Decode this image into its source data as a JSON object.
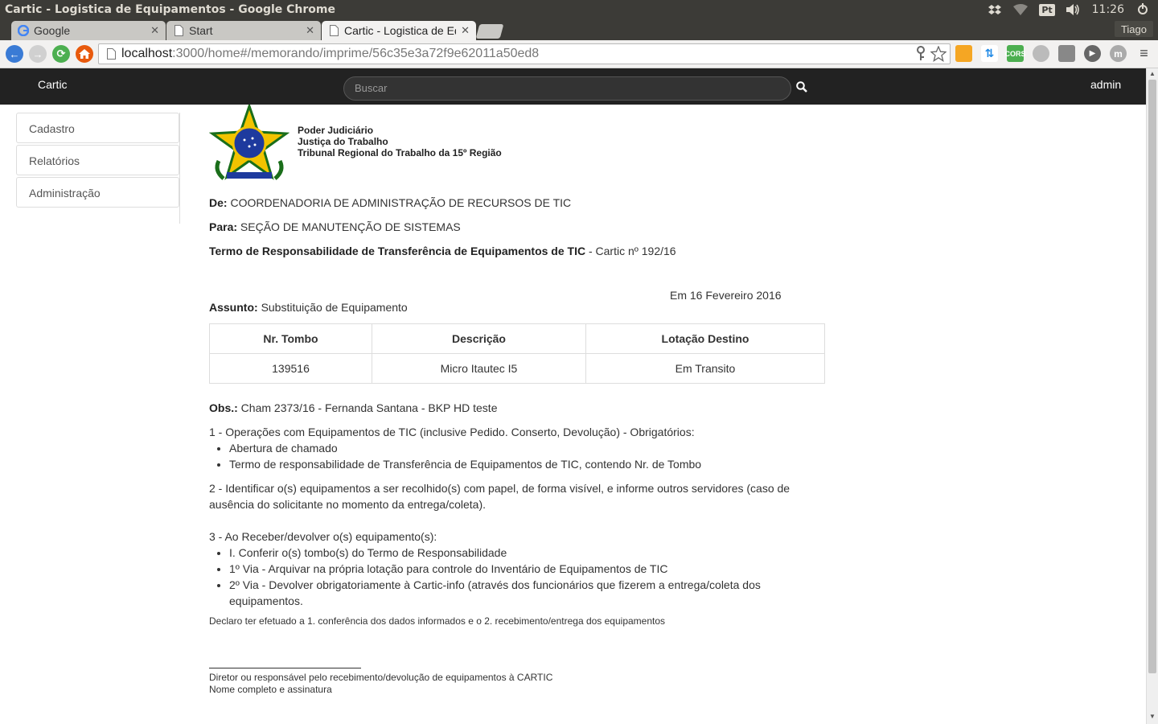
{
  "os": {
    "window_title": "Cartic - Logistica de Equipamentos - Google Chrome",
    "keyboard_layout": "Pt",
    "clock": "11:26"
  },
  "browser": {
    "tabs": [
      {
        "label": "Google",
        "active": false
      },
      {
        "label": "Start",
        "active": false
      },
      {
        "label": "Cartic - Logistica de Equipamentos",
        "active": true
      }
    ],
    "profile_name": "Tiago",
    "url_host": "localhost",
    "url_rest": ":3000/home#/memorando/imprime/56c35e3a72f9e62011a50ed8",
    "extension_cors_label": "CORS",
    "extension_m_label": "m"
  },
  "navbar": {
    "brand": "Cartic",
    "search_placeholder": "Buscar",
    "user": "admin"
  },
  "sidebar": {
    "items": [
      {
        "label": "Cadastro"
      },
      {
        "label": "Relatórios"
      },
      {
        "label": "Administração"
      }
    ]
  },
  "document": {
    "org_line1": "Poder Judiciário",
    "org_line2": "Justiça do Trabalho",
    "org_line3": "Tribunal Regional do Trabalho da 15º Região",
    "from_label": "De:",
    "from_value": "COORDENADORIA DE ADMINISTRAÇÃO DE RECURSOS DE TIC",
    "to_label": "Para:",
    "to_value": "SEÇÃO DE MANUTENÇÃO DE SISTEMAS",
    "term_title": "Termo de Responsabilidade de Transferência de Equipamentos de TIC",
    "term_number": "- Cartic nº 192/16",
    "date": "Em 16 Fevereiro 2016",
    "subject_label": "Assunto:",
    "subject_value": "Substituição de Equipamento",
    "table": {
      "headers": [
        "Nr. Tombo",
        "Descrição",
        "Lotação Destino"
      ],
      "rows": [
        [
          "139516",
          "Micro Itautec I5",
          "Em Transito"
        ]
      ]
    },
    "obs_label": "Obs.:",
    "obs_value": "Cham 2373/16 - Fernanda Santana - BKP HD teste",
    "section1_title": "1 - Operações com Equipamentos de TIC (inclusive Pedido. Conserto, Devolução) - Obrigatórios:",
    "section1_items": [
      "Abertura de chamado",
      "Termo de responsabilidade de Transferência de Equipamentos de TIC, contendo Nr. de Tombo"
    ],
    "section2": "2 - Identificar o(s) equipamentos a ser recolhido(s) com papel, de forma visível, e informe outros servidores (caso de ausência do solicitante no momento da entrega/coleta).",
    "section3_title": "3 - Ao Receber/devolver o(s) equipamento(s):",
    "section3_items": [
      "I. Conferir o(s) tombo(s) do Termo de Responsabilidade",
      "1º Via - Arquivar na própria lotação para controle do Inventário de Equipamentos de TIC",
      "2º Via - Devolver obrigatoriamente à Cartic-info (através dos funcionários que fizerem a entrega/coleta dos equipamentos."
    ],
    "declaration": "Declaro ter efetuado a 1. conferência dos dados informados e o 2. recebimento/entrega dos equipamentos",
    "signature_role": "Diretor ou responsável pelo recebimento/devolução de equipamentos à CARTIC",
    "signature_hint": "Nome completo e assinatura"
  },
  "colors": {
    "navbar_bg": "#222222",
    "os_bar_bg": "#3c3b37",
    "back_button": "#3a7bd5",
    "reload_button": "#4caf50",
    "home_button": "#e8590c"
  }
}
